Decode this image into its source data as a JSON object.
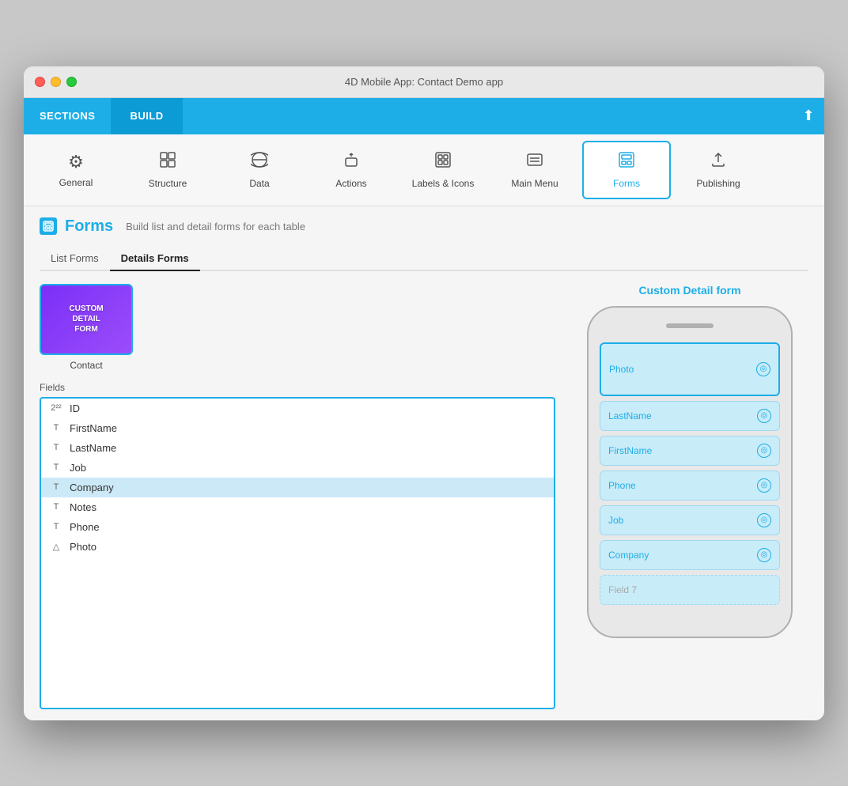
{
  "window": {
    "title": "4D Mobile App: Contact Demo app"
  },
  "nav": {
    "sections_label": "SECTIONS",
    "build_label": "BUILD"
  },
  "toolbar": {
    "items": [
      {
        "id": "general",
        "label": "General",
        "icon": "⚙"
      },
      {
        "id": "structure",
        "label": "Structure",
        "icon": "⊞"
      },
      {
        "id": "data",
        "label": "Data",
        "icon": "🌐"
      },
      {
        "id": "actions",
        "label": "Actions",
        "icon": "☝"
      },
      {
        "id": "labels-icons",
        "label": "Labels & Icons",
        "icon": "⊞"
      },
      {
        "id": "main-menu",
        "label": "Main Menu",
        "icon": "☰"
      },
      {
        "id": "forms",
        "label": "Forms",
        "icon": "⬛"
      },
      {
        "id": "publishing",
        "label": "Publishing",
        "icon": "⬆"
      }
    ],
    "active": "forms"
  },
  "page": {
    "title": "Forms",
    "subtitle": "Build list and detail forms for each table",
    "tabs": [
      {
        "id": "list-forms",
        "label": "List Forms"
      },
      {
        "id": "details-forms",
        "label": "Details Forms"
      }
    ],
    "active_tab": "details-forms"
  },
  "form_card": {
    "label": "Contact",
    "inner_lines": [
      "CUSTOM",
      "DETAIL",
      "FORM"
    ]
  },
  "fields": {
    "label": "Fields",
    "items": [
      {
        "id": "ID",
        "type": "num",
        "type_icon": "2²²",
        "name": "ID"
      },
      {
        "id": "FirstName",
        "type": "text",
        "type_icon": "T",
        "name": "FirstName"
      },
      {
        "id": "LastName",
        "type": "text",
        "type_icon": "T",
        "name": "LastName"
      },
      {
        "id": "Job",
        "type": "text",
        "type_icon": "T",
        "name": "Job"
      },
      {
        "id": "Company",
        "type": "text",
        "type_icon": "T",
        "name": "Company",
        "selected": true
      },
      {
        "id": "Notes",
        "type": "text",
        "type_icon": "T",
        "name": "Notes"
      },
      {
        "id": "Phone",
        "type": "text",
        "type_icon": "T",
        "name": "Phone"
      },
      {
        "id": "Photo",
        "type": "image",
        "type_icon": "△",
        "name": "Photo"
      }
    ]
  },
  "custom_form": {
    "title": "Custom Detail form",
    "fields": [
      {
        "label": "Photo",
        "type": "photo"
      },
      {
        "label": "LastName",
        "type": "normal"
      },
      {
        "label": "FirstName",
        "type": "normal"
      },
      {
        "label": "Phone",
        "type": "normal"
      },
      {
        "label": "Job",
        "type": "normal"
      },
      {
        "label": "Company",
        "type": "normal"
      },
      {
        "label": "Field 7",
        "type": "dashed"
      }
    ]
  }
}
